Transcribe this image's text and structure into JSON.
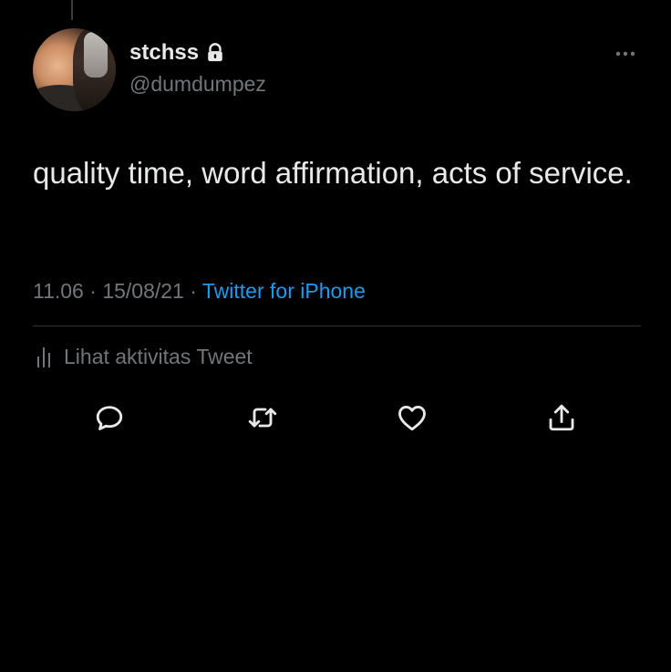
{
  "user": {
    "display_name": "stchss",
    "handle": "@dumdumpez",
    "protected_icon": "lock-icon"
  },
  "tweet": {
    "text": "quality time, word affirmation, acts of service.",
    "time": "11.06",
    "date": "15/08/21",
    "separator": "·",
    "source": "Twitter for iPhone"
  },
  "activity": {
    "label": "Lihat aktivitas Tweet",
    "icon": "analytics-icon"
  },
  "actions": [
    {
      "name": "reply",
      "icon": "reply-icon"
    },
    {
      "name": "retweet",
      "icon": "retweet-icon"
    },
    {
      "name": "like",
      "icon": "heart-icon"
    },
    {
      "name": "share",
      "icon": "share-icon"
    }
  ],
  "colors": {
    "background": "#000000",
    "primary_text": "#e7e9ea",
    "secondary_text": "#71767b",
    "link": "#1d9bf0",
    "divider": "#2f3336"
  }
}
